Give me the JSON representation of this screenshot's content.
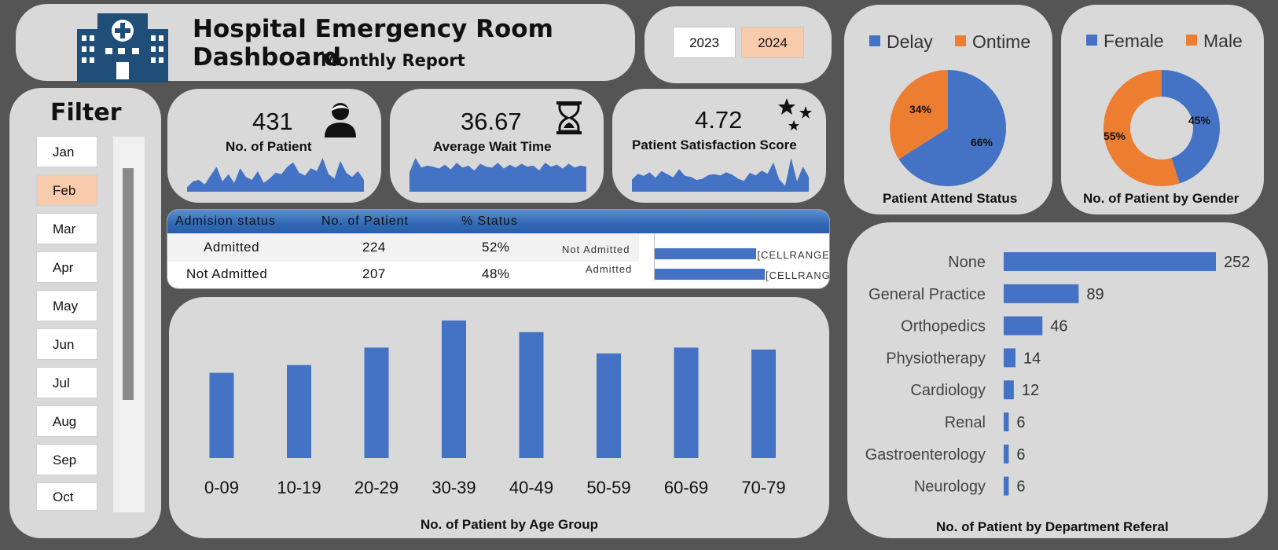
{
  "header": {
    "title": "Hospital Emergency Room Dashboard",
    "subtitle": "Monthly Report"
  },
  "years": {
    "options": [
      "2023",
      "2024"
    ],
    "selected": "2024"
  },
  "filter": {
    "title": "Filter",
    "months": [
      "Jan",
      "Feb",
      "Mar",
      "Apr",
      "May",
      "Jun",
      "Jul",
      "Aug",
      "Sep",
      "Oct"
    ],
    "selected": "Feb"
  },
  "kpis": {
    "patients": {
      "value": "431",
      "label": "No. of Patient",
      "icon": "person-icon"
    },
    "wait_time": {
      "value": "36.67",
      "label": "Average Wait Time",
      "icon": "hourglass-icon"
    },
    "satisfaction": {
      "value": "4.72",
      "label": "Patient Satisfaction Score",
      "icon": "stars-icon"
    }
  },
  "admission": {
    "headers": [
      "Admision status",
      "No. of Patient",
      "% Status"
    ],
    "rows": [
      {
        "status": "Admitted",
        "count": "224",
        "pct": "52%"
      },
      {
        "status": "Not Admitted",
        "count": "207",
        "pct": "48%"
      }
    ],
    "bars": [
      {
        "label": "Not Admitted",
        "value": 207,
        "tag": "[CELLRANGE"
      },
      {
        "label": "Admitted",
        "value": 224,
        "tag": "[CELLRANG"
      }
    ]
  },
  "colors": {
    "blue": "#4472c4",
    "orange": "#ed7d31",
    "panel": "#d9d9d9",
    "background": "#555555",
    "selected": "#f8cbad"
  },
  "chart_data": [
    {
      "type": "pie",
      "title": "Patient Attend Status",
      "categories": [
        "Delay",
        "Ontime"
      ],
      "values": [
        66,
        34
      ],
      "labels": [
        "66%",
        "34%"
      ],
      "legend": "top"
    },
    {
      "type": "pie",
      "subtype": "donut",
      "title": "No. of Patient by Gender",
      "categories": [
        "Female",
        "Male"
      ],
      "values": [
        45,
        55
      ],
      "labels": [
        "45%",
        "55%"
      ],
      "legend": "top"
    },
    {
      "type": "bar",
      "title": "No. of Patient by Age Group",
      "categories": [
        "0-09",
        "10-19",
        "20-29",
        "30-39",
        "40-49",
        "50-59",
        "60-69",
        "70-79"
      ],
      "values": [
        44,
        48,
        57,
        71,
        65,
        54,
        57,
        56
      ]
    },
    {
      "type": "bar",
      "orientation": "horizontal",
      "title": "No. of Patient by Department Referal",
      "categories": [
        "None",
        "General Practice",
        "Orthopedics",
        "Physiotherapy",
        "Cardiology",
        "Renal",
        "Gastroenterology",
        "Neurology"
      ],
      "values": [
        252,
        89,
        46,
        14,
        12,
        6,
        6,
        6
      ]
    },
    {
      "type": "area",
      "title": "No. of Patient",
      "values": [
        6,
        10,
        11,
        8,
        14,
        20,
        10,
        15,
        9,
        19,
        13,
        11,
        17,
        9,
        12,
        16,
        15,
        20,
        23,
        16,
        14,
        19,
        17,
        26,
        15,
        12,
        24,
        16,
        13,
        17,
        11
      ]
    },
    {
      "type": "area",
      "title": "Average Wait Time",
      "values": [
        40,
        55,
        45,
        47,
        46,
        44,
        48,
        43,
        50,
        45,
        47,
        42,
        49,
        46,
        45,
        50,
        44,
        48,
        45,
        49,
        46,
        47,
        42,
        50,
        46,
        48,
        44,
        49,
        45,
        47,
        46
      ]
    },
    {
      "type": "area",
      "title": "Patient Satisfaction Score",
      "values": [
        4.0,
        5.3,
        4.8,
        5.6,
        4.4,
        5.9,
        5.2,
        4.5,
        6.3,
        4.8,
        4.6,
        3.9,
        4.2,
        5.0,
        5.2,
        4.9,
        5.6,
        5.1,
        4.2,
        3.7,
        5.5,
        4.9,
        6.0,
        5.3,
        7.8,
        4.0,
        2.6,
        8.8,
        3.6,
        6.9,
        4.6
      ]
    }
  ]
}
